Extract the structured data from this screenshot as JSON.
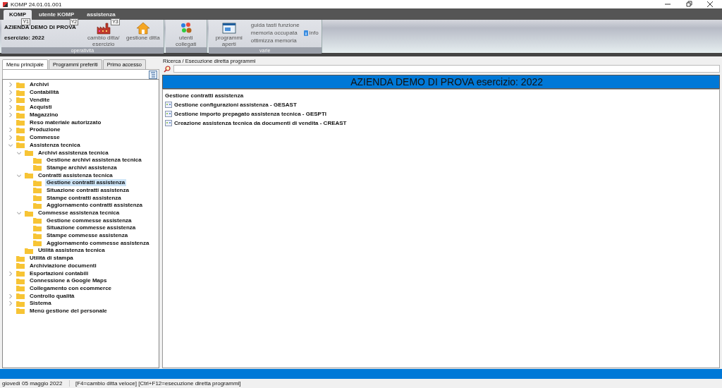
{
  "window": {
    "title": "KOMP 24.01.01.001"
  },
  "menu_tabs": [
    {
      "label": "KOMP",
      "keytip": "Y1",
      "selected": true
    },
    {
      "label": "utente KOMP",
      "keytip": "Y2",
      "selected": false
    },
    {
      "label": "assistenza",
      "keytip": "Y3",
      "selected": false
    }
  ],
  "ribbon": {
    "company": "AZIENDA DEMO DI PROVA",
    "year": "esercizio: 2022",
    "groups": [
      {
        "label": "operatività",
        "buttons": [
          {
            "kind": "factory",
            "label": "cambio ditta/ esercizio"
          },
          {
            "kind": "house",
            "label": "gestione ditta"
          }
        ]
      },
      {
        "buttons": [
          {
            "kind": "users",
            "label": "utenti collegati"
          }
        ]
      },
      {
        "label": "varie",
        "buttons": [
          {
            "kind": "window",
            "label": "programmi aperti"
          }
        ],
        "links": [
          "guida tasti funzione",
          "memoria occupata",
          "ottimizza memoria"
        ],
        "info": "info"
      }
    ]
  },
  "left_tabs": [
    {
      "label": "Menu principale",
      "selected": true
    },
    {
      "label": "Programmi preferiti",
      "selected": false
    },
    {
      "label": "Primo accesso",
      "selected": false
    }
  ],
  "tree": [
    {
      "label": "Archivi",
      "expanded": false
    },
    {
      "label": "Contabilità",
      "expanded": false
    },
    {
      "label": "Vendite",
      "expanded": false
    },
    {
      "label": "Acquisti",
      "expanded": false
    },
    {
      "label": "Magazzino",
      "expanded": false
    },
    {
      "label": "Reso materiale autorizzato"
    },
    {
      "label": "Produzione",
      "expanded": false
    },
    {
      "label": "Commesse",
      "expanded": false
    },
    {
      "label": "Assistenza tecnica",
      "expanded": true,
      "children": [
        {
          "label": "Archivi assistenza tecnica",
          "expanded": true,
          "children": [
            {
              "label": "Gestione archivi assistenza tecnica",
              "selected": false
            },
            {
              "label": "Stampe archivi assistenza",
              "selected": false
            }
          ]
        },
        {
          "label": "Contratti assistenza tecnica",
          "expanded": true,
          "children": [
            {
              "label": "Gestione contratti assistenza",
              "selected": true
            },
            {
              "label": "Situazione contratti assistenza",
              "selected": false
            },
            {
              "label": "Stampe contratti assistenza",
              "selected": false
            },
            {
              "label": "Aggiornamento contratti assistenza",
              "selected": false
            }
          ]
        },
        {
          "label": "Commesse assistenza tecnica",
          "expanded": true,
          "children": [
            {
              "label": "Gestione commesse assistenza",
              "selected": false
            },
            {
              "label": "Situazione commesse assistenza",
              "selected": false
            },
            {
              "label": "Stampe commesse assistenza",
              "selected": false
            },
            {
              "label": "Aggiornamento commesse assistenza",
              "selected": false
            }
          ]
        },
        {
          "label": "Utilità assistenza tecnica"
        }
      ]
    },
    {
      "label": "Utilità di stampa"
    },
    {
      "label": "Archiviazione documenti"
    },
    {
      "label": "Esportazioni contabili",
      "expanded": false
    },
    {
      "label": "Connessione a Google Maps"
    },
    {
      "label": "Collegamento con ecommerce"
    },
    {
      "label": "Controllo qualità",
      "expanded": false
    },
    {
      "label": "Sistema",
      "expanded": false
    },
    {
      "label": "Menù gestione del personale"
    }
  ],
  "search": {
    "label": "Ricerca / Esecuzione diretta programmi"
  },
  "header": "AZIENDA DEMO DI PROVA  esercizio: 2022",
  "content": {
    "title": "Gestione contratti assistenza",
    "programs": [
      "Gestione configurazioni assistenza - GESAST",
      "Gestione importo prepagato assistenza tecnica - GESPTI",
      "Creazione assistenza tecnica da documenti di vendita - CREAST"
    ]
  },
  "status_bar": {
    "date": "giovedì 05 maggio 2022",
    "hint": "[F4=cambio ditta veloce] [Ctrl+F12=esecuzione diretta programmi]"
  }
}
